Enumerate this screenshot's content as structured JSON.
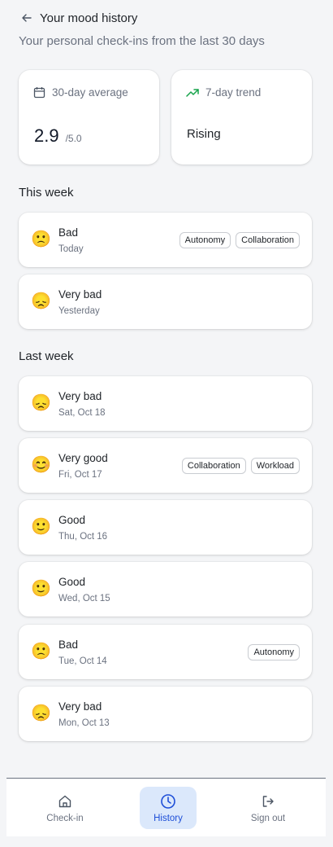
{
  "header": {
    "back_icon": "arrow-left-icon",
    "title": "Your mood history",
    "subtitle": "Your personal check-ins from the last 30 days"
  },
  "summary": {
    "average": {
      "icon": "calendar-icon",
      "label": "30-day average",
      "value": "2.9",
      "scale": "/5.0"
    },
    "trend": {
      "icon": "trending-up-icon",
      "label": "7-day trend",
      "value": "Rising",
      "accent": "#16a34a"
    }
  },
  "sections": [
    {
      "title": "This week",
      "entries": [
        {
          "emoji": "🙁",
          "mood": "Bad",
          "date": "Today",
          "tags": [
            "Autonomy",
            "Collaboration"
          ]
        },
        {
          "emoji": "😞",
          "mood": "Very bad",
          "date": "Yesterday",
          "tags": []
        }
      ]
    },
    {
      "title": "Last week",
      "entries": [
        {
          "emoji": "😞",
          "mood": "Very bad",
          "date": "Sat, Oct 18",
          "tags": []
        },
        {
          "emoji": "😊",
          "mood": "Very good",
          "date": "Fri, Oct 17",
          "tags": [
            "Collaboration",
            "Workload"
          ]
        },
        {
          "emoji": "🙂",
          "mood": "Good",
          "date": "Thu, Oct 16",
          "tags": []
        },
        {
          "emoji": "🙂",
          "mood": "Good",
          "date": "Wed, Oct 15",
          "tags": []
        },
        {
          "emoji": "🙁",
          "mood": "Bad",
          "date": "Tue, Oct 14",
          "tags": [
            "Autonomy"
          ]
        },
        {
          "emoji": "😞",
          "mood": "Very bad",
          "date": "Mon, Oct 13",
          "tags": []
        }
      ]
    }
  ],
  "nav": {
    "items": [
      {
        "icon": "home-icon",
        "label": "Check-in",
        "active": false
      },
      {
        "icon": "clock-icon",
        "label": "History",
        "active": true
      },
      {
        "icon": "sign-out-icon",
        "label": "Sign out",
        "active": false
      }
    ],
    "active_color": "#1d4ed8",
    "active_bg": "#dbe8fb"
  }
}
